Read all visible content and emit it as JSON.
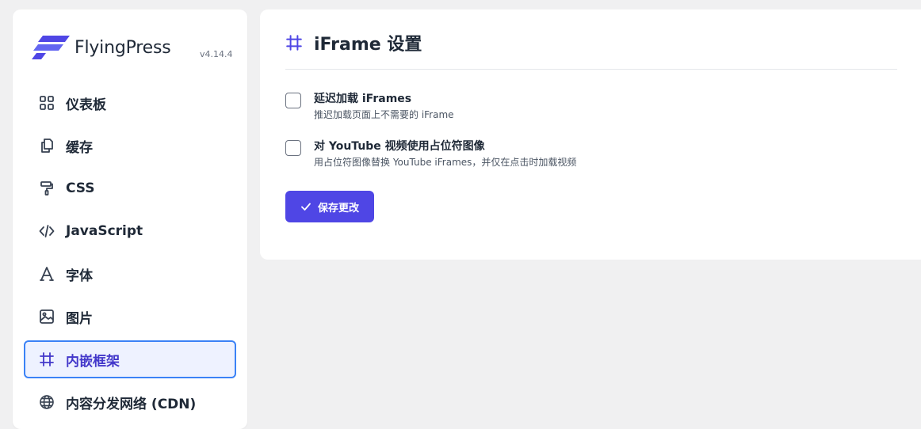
{
  "brand": {
    "name": "FlyingPress",
    "version": "v4.14.4",
    "accent": "#4f46e5"
  },
  "sidebar": {
    "items": [
      {
        "label": "仪表板",
        "icon": "grid-icon"
      },
      {
        "label": "缓存",
        "icon": "copy-icon"
      },
      {
        "label": "CSS",
        "icon": "paint-roller-icon"
      },
      {
        "label": "JavaScript",
        "icon": "code-icon"
      },
      {
        "label": "字体",
        "icon": "font-icon"
      },
      {
        "label": "图片",
        "icon": "image-icon"
      },
      {
        "label": "内嵌框架",
        "icon": "hash-icon",
        "active": true
      },
      {
        "label": "内容分发网络 (CDN)",
        "icon": "globe-icon"
      }
    ]
  },
  "main": {
    "title": "iFrame 设置",
    "title_icon": "hash-icon",
    "options": [
      {
        "title": "延迟加载 iFrames",
        "description": "推迟加载页面上不需要的 iFrame",
        "checked": false
      },
      {
        "title": "对 YouTube 视频使用占位符图像",
        "description": "用占位符图像替换 YouTube iFrames，并仅在点击时加载视频",
        "checked": false
      }
    ],
    "save_label": "保存更改"
  }
}
